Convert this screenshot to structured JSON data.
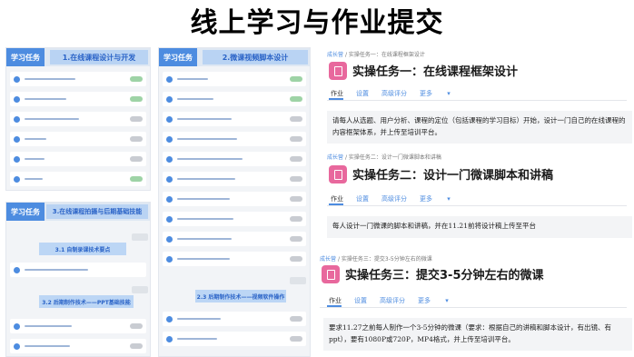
{
  "page_title": "线上学习与作业提交",
  "left": {
    "panel1": {
      "tag": "学习任务",
      "module": "1.在线课程设计与开发"
    },
    "panel2": {
      "tag": "学习任务",
      "module": "2.微课视频脚本设计"
    },
    "panel3": {
      "tag": "学习任务",
      "module": "3.在线课程拍摄与后期基础技能",
      "sub1": "3.1 自制录课技术要点",
      "sub2": "3.2 后期制作技术——PPT基础技能"
    },
    "panel2_sub": "2.3 后期制作技术——视频软件操作"
  },
  "tasks": [
    {
      "crumb_link": "成长营",
      "crumb_sep": "/",
      "crumb_text": "实操任务一：在线课程框架设计",
      "title": "实操任务一：在线课程框架设计",
      "tabs": [
        "作业",
        "设置",
        "高级评分",
        "更多"
      ],
      "desc": "请每人从选题、用户分析、课程的定位（包括课程的学习目标）开始，设计一门自己的在线课程的内容框架体系，并上传至培训平台。"
    },
    {
      "crumb_link": "成长营",
      "crumb_sep": "/",
      "crumb_text": "实操任务二：设计一门微课脚本和讲稿",
      "title": "实操任务二：设计一门微课脚本和讲稿",
      "tabs": [
        "作业",
        "设置",
        "高级评分",
        "更多"
      ],
      "desc": "每人设计一门微课的脚本和讲稿，并在11.21前将设计稿上传至平台"
    },
    {
      "crumb_link": "成长营",
      "crumb_sep": "/",
      "crumb_text": "实操任务三：提交3-5分钟左右的微课",
      "title": "实操任务三：提交3-5分钟左右的微课",
      "tabs": [
        "作业",
        "设置",
        "高级评分",
        "更多"
      ],
      "desc": "要求11.27之前每人制作一个3-5分钟的微课（要求：根据自己的讲稿和脚本设计，有出镜、有ppt），要有1080P或720P，MP4格式，并上传至培训平台。"
    }
  ],
  "colors": {
    "accent": "#4d8ce0",
    "badge": "#e8689d",
    "panel_bg": "#f2f4f7"
  }
}
